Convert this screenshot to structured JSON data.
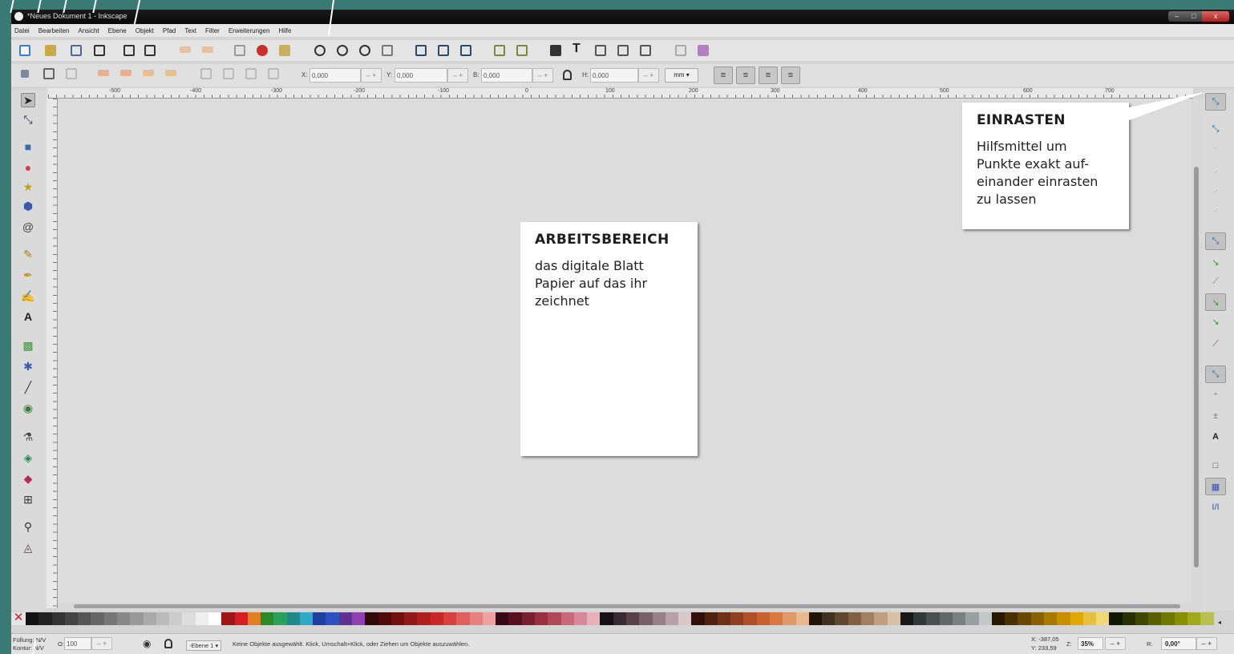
{
  "window": {
    "title": "*Neues Dokument 1 - Inkscape",
    "controls": [
      "–",
      "□",
      "x"
    ]
  },
  "menubar": [
    "Datei",
    "Bearbeiten",
    "Ansicht",
    "Ebene",
    "Objekt",
    "Pfad",
    "Text",
    "Filter",
    "Erweiterungen",
    "Hilfe"
  ],
  "toolbar2": {
    "x_label": "X:",
    "x_value": "0,000",
    "y_label": "Y:",
    "y_value": "0,000",
    "w_label": "B:",
    "w_value": "0,000",
    "h_label": "H:",
    "h_value": "0,000",
    "spin_minus": "–",
    "spin_plus": "+",
    "unit": "mm ▾"
  },
  "ruler_ticks": [
    "-500",
    "-400",
    "-300",
    "-200",
    "-100",
    "0",
    "100",
    "200",
    "300",
    "400",
    "500",
    "600",
    "700"
  ],
  "callouts": {
    "workspace": {
      "title": "ARBEITSBEREICH",
      "text": "das digitale Blatt Papier auf das ihr zeichnet"
    },
    "snap": {
      "title": "EINRASTEN",
      "text": "Hilfsmittel um Punkte exakt auf-einander einrasten zu lassen"
    }
  },
  "statusbar": {
    "fill_label": "Füllung: N/V",
    "stroke_label": "Kontur: N/V",
    "opacity_label": "O:",
    "opacity_value": "100",
    "layer": "-Ebene 1 ▾",
    "message": "Keine Objekte ausgewählt. Klick, Umschalt+Klick, oder Ziehen um Objekte auszuwählen.",
    "cursor_x": "X:  -387,05",
    "cursor_y": "Y:   233,59",
    "zoom_label": "Z:",
    "zoom": "35%",
    "rotation_label": "R:",
    "rotation": "0,00°",
    "minus": "–",
    "plus": "+"
  },
  "palette_colors": [
    "#111111",
    "#222222",
    "#333333",
    "#444444",
    "#555555",
    "#666666",
    "#777777",
    "#888888",
    "#999999",
    "#aaaaaa",
    "#bbbbbb",
    "#cccccc",
    "#dddddd",
    "#eeeeee",
    "#ffffff",
    "#a01515",
    "#d42020",
    "#e08020",
    "#2a8a2a",
    "#2aa05a",
    "#208888",
    "#30a8c8",
    "#2040a0",
    "#3050c0",
    "#603090",
    "#9040b0",
    "#300808",
    "#500a0a",
    "#701010",
    "#901818",
    "#b02020",
    "#c82828",
    "#d84040",
    "#e06060",
    "#e88080",
    "#f0a0a0",
    "#380818",
    "#581020",
    "#782030",
    "#983040",
    "#b04858",
    "#c86878",
    "#d88898",
    "#e8b0b8",
    "#181018",
    "#382830",
    "#584048",
    "#786068",
    "#988088",
    "#b8a0a8",
    "#d8c8c8",
    "#301008",
    "#502010",
    "#703018",
    "#904020",
    "#b05028",
    "#c86030",
    "#d87840",
    "#e09868",
    "#e8b890",
    "#201408",
    "#403020",
    "#604830",
    "#806040",
    "#a08060",
    "#c0a080",
    "#d8c0a8",
    "#181818",
    "#303838",
    "#485050",
    "#606868",
    "#788080",
    "#98a0a0",
    "#c0c8c8",
    "#281800",
    "#483000",
    "#684800",
    "#886000",
    "#a87800",
    "#c89000",
    "#e0a800",
    "#e8c040",
    "#f0d878",
    "#101800",
    "#283000",
    "#404800",
    "#586000",
    "#707800",
    "#889000",
    "#a0a820",
    "#b8c050"
  ]
}
